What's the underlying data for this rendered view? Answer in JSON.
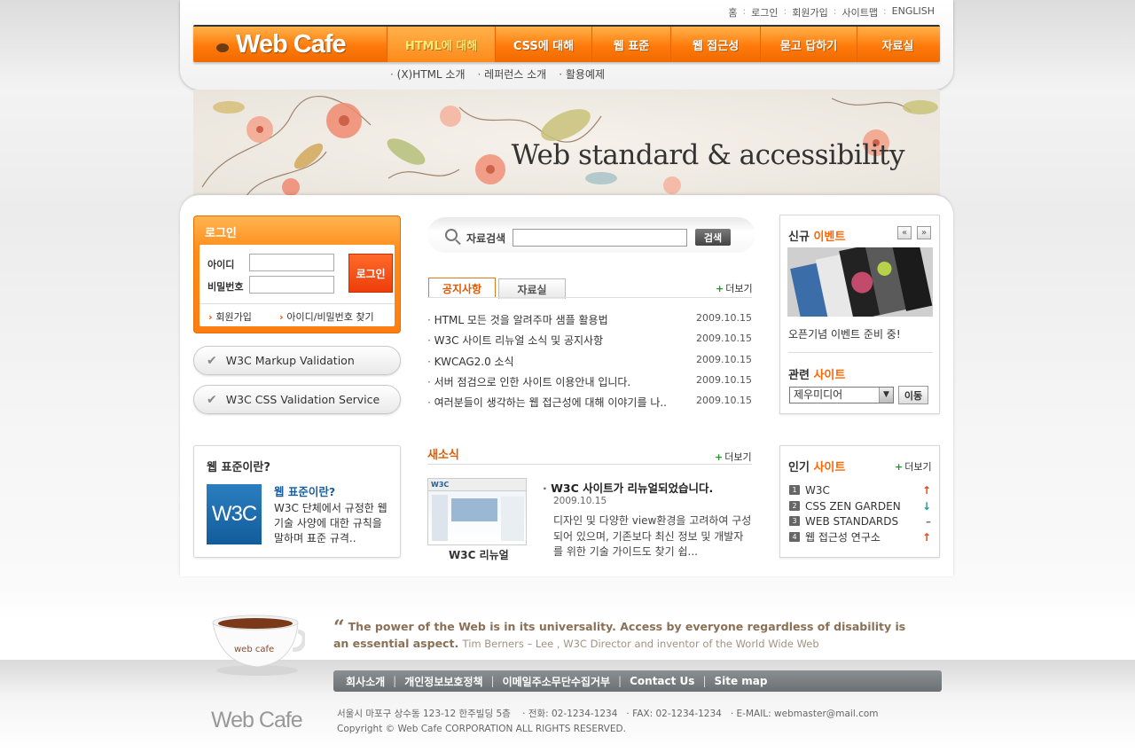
{
  "header": {
    "top_links": [
      "홈",
      "로그인",
      "회원가입",
      "사이트맵",
      "ENGLISH"
    ],
    "logo": "Web Cafe",
    "nav": [
      "HTML에 대해",
      "CSS에 대해",
      "웹 표준",
      "웹 접근성",
      "묻고 답하기",
      "자료실"
    ],
    "subnav": [
      "(X)HTML 소개",
      "레퍼런스 소개",
      "활용예제"
    ],
    "banner_text": "Web standard & accessibility"
  },
  "login": {
    "title": "로그인",
    "id_label": "아이디",
    "pw_label": "비밀번호",
    "button": "로그인",
    "join": "회원가입",
    "find": "아이디/비밀번호 찾기"
  },
  "validation": {
    "markup": "W3C Markup Validation",
    "css": "W3C CSS Validation Service"
  },
  "search": {
    "label": "자료검색",
    "button": "검색",
    "value": ""
  },
  "notice": {
    "tabs": [
      "공지사항",
      "자료실"
    ],
    "more": "더보기",
    "items": [
      {
        "title": "HTML 모든 것을 알려주마 샘플 활용법",
        "date": "2009.10.15"
      },
      {
        "title": "W3C 사이트 리뉴얼 소식 및 공지사항",
        "date": "2009.10.15"
      },
      {
        "title": "KWCAG2.0 소식",
        "date": "2009.10.15"
      },
      {
        "title": "서버 점검으로 인한 사이트 이용안내 입니다.",
        "date": "2009.10.15"
      },
      {
        "title": "여러분들이 생각하는 웹 접근성에 대해 이야기를 나..",
        "date": "2009.10.15"
      }
    ]
  },
  "event": {
    "title_a": "신규",
    "title_b": "이벤트",
    "caption": "오픈기념 이벤트 준비 중!",
    "prev": "«",
    "next": "»",
    "related_a": "관련",
    "related_b": "사이트",
    "selected": "제우미디어",
    "go": "이동"
  },
  "webstd": {
    "title": "웹 표준이란?",
    "logo": "W3C",
    "subtitle": "웹 표준이란?",
    "desc": "W3C 단체에서 규정한 웹 기술 사양에 대한 규칙을 말하며 표준 규격.."
  },
  "news": {
    "title": "새소식",
    "more": "더보기",
    "headline": "W3C 사이트가 리뉴얼되었습니다.",
    "date": "2009.10.15",
    "body": "디자인 및 다양한 view환경을 고려하여 구성되어 있으며, 기존보다 최신 정보 및 개발자를 위한 기술 가이드도 찾기 쉽...",
    "thumb_caption": "W3C 리뉴얼",
    "thumb_logo": "W3C"
  },
  "popular": {
    "title_a": "인기",
    "title_b": "사이트",
    "more": "더보기",
    "items": [
      {
        "num": "1",
        "name": "W3C",
        "trend": "up"
      },
      {
        "num": "2",
        "name": "CSS ZEN GARDEN",
        "trend": "down"
      },
      {
        "num": "3",
        "name": "WEB STANDARDS",
        "trend": "same"
      },
      {
        "num": "4",
        "name": "웹 접근성 연구소",
        "trend": "up"
      }
    ]
  },
  "footer": {
    "cup_label": "web cafe",
    "quote": "The power of the Web is in its universality. Access by everyone regardless of disability is an essential aspect.",
    "author": "Tim Berners – Lee , W3C Director and inventor of the World Wide Web",
    "nav": [
      "회사소개",
      "개인정보보호정책",
      "이메일주소무단수집거부",
      "Contact Us",
      "Site map"
    ],
    "logo": "Web Cafe",
    "address": "서울시 마포구 상수동 123-12 한주빌딩 5층",
    "tel": "전화: 02-1234-1234",
    "fax": "FAX: 02-1234-1234",
    "email": "E-MAIL: webmaster@mail.com",
    "copyright": "Copyright © Web Cafe CORPORATION ALL RIGHTS RESERVED."
  },
  "colors": {
    "accent": "#ff7a0a",
    "accent_text": "#ff6600",
    "footer_nav": "#6a7073"
  }
}
